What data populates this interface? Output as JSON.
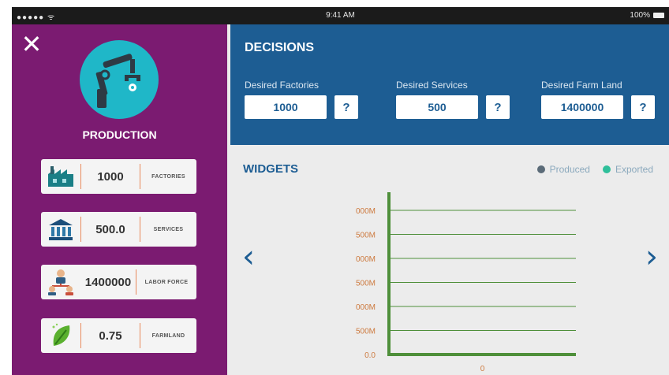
{
  "status_bar": {
    "signal": "●●●●● ᯤ",
    "time": "9:41 AM",
    "battery": "100%"
  },
  "production": {
    "title": "PRODUCTION",
    "stats": [
      {
        "value": "1000",
        "label": "FACTORIES",
        "icon": "factory-icon"
      },
      {
        "value": "500.0",
        "label": "SERVICES",
        "icon": "bank-icon"
      },
      {
        "value": "1400000",
        "label": "LABOR FORCE",
        "icon": "people-icon"
      },
      {
        "value": "0.75",
        "label": "FARMLAND",
        "icon": "leaf-icon"
      }
    ]
  },
  "decisions": {
    "title": "DECISIONS",
    "fields": [
      {
        "label": "Desired Factories",
        "value": "1000",
        "help": "?"
      },
      {
        "label": "Desired Services",
        "value": "500",
        "help": "?"
      },
      {
        "label": "Desired Farm Land",
        "value": "1400000",
        "help": "?"
      }
    ]
  },
  "widgets": {
    "title": "WIDGETS",
    "legend": [
      {
        "name": "Produced",
        "color": "#5b6b78"
      },
      {
        "name": "Exported",
        "color": "#2fbf9a"
      }
    ]
  },
  "chart_data": {
    "type": "bar",
    "categories": [
      "0"
    ],
    "y_tick_labels": [
      "0.0",
      "500M",
      "000M",
      "500M",
      "000M",
      "500M",
      "000M"
    ],
    "series": [
      {
        "name": "Produced",
        "values": [
          0
        ]
      },
      {
        "name": "Exported",
        "values": [
          0
        ]
      }
    ]
  },
  "colors": {
    "sidebar": "#7b1b71",
    "decisions": "#1d5d93",
    "axis": "#4e8f3a",
    "tick_text": "#cd7a3f"
  }
}
